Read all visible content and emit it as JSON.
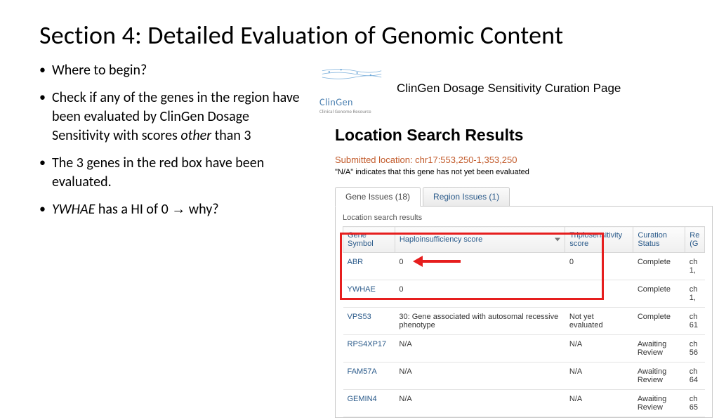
{
  "title": "Section 4: Detailed Evaluation of Genomic Content",
  "bullets": {
    "b1": "Where to begin?",
    "b2a": "Check if any of the genes in the region have been evaluated by ClinGen Dosage Sensitivity with scores ",
    "b2i": "other",
    "b2b": " than 3",
    "b3": "The 3 genes in the red box have been evaluated.",
    "b4a": "YWHAE",
    "b4b": " has a HI of 0 ",
    "b4arrow": "→",
    "b4c": " why?"
  },
  "clingen": {
    "logo_name": "ClinGen",
    "logo_sub": "Clinical Genome Resource",
    "page_title": "ClinGen Dosage Sensitivity Curation Page",
    "section_title": "Location Search Results",
    "submitted_label": "Submitted location: chr17:553,250-1,353,250",
    "na_note": "\"N/A\" indicates that this gene has not yet been evaluated",
    "tabs": {
      "gene": "Gene Issues (18)",
      "region": "Region Issues (1)"
    },
    "panel_sub": "Location search results",
    "cols": {
      "gene": "Gene Symbol",
      "hi": "Haploinsufficiency score",
      "ts": "Triplosensitivity score",
      "cs": "Curation Status",
      "re": "Re\n(G"
    },
    "rows": [
      {
        "gene": "ABR",
        "hi": "0",
        "ts": "0",
        "cs": "Complete",
        "re": "ch\n1,"
      },
      {
        "gene": "YWHAE",
        "hi": "0",
        "ts": "",
        "cs": "Complete",
        "re": "ch\n1,"
      },
      {
        "gene": "VPS53",
        "hi": "30: Gene associated with autosomal recessive phenotype",
        "ts": "Not yet evaluated",
        "cs": "Complete",
        "re": "ch\n61"
      },
      {
        "gene": "RPS4XP17",
        "hi": "N/A",
        "ts": "N/A",
        "cs": "Awaiting Review",
        "re": "ch\n56"
      },
      {
        "gene": "FAM57A",
        "hi": "N/A",
        "ts": "N/A",
        "cs": "Awaiting Review",
        "re": "ch\n64"
      },
      {
        "gene": "GEMIN4",
        "hi": "N/A",
        "ts": "N/A",
        "cs": "Awaiting Review",
        "re": "ch\n65"
      }
    ]
  }
}
